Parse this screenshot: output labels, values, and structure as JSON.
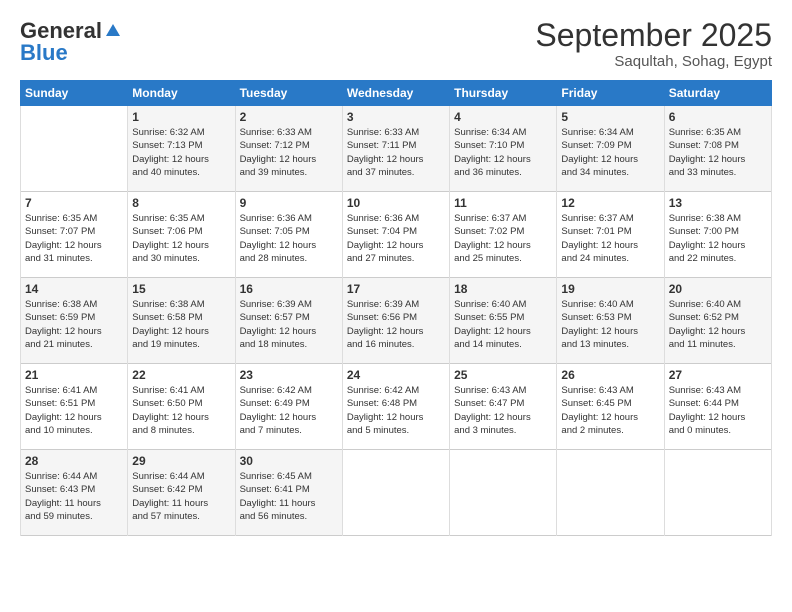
{
  "logo": {
    "general": "General",
    "blue": "Blue",
    "tagline": ""
  },
  "title": "September 2025",
  "location": "Saqultah, Sohag, Egypt",
  "header_days": [
    "Sunday",
    "Monday",
    "Tuesday",
    "Wednesday",
    "Thursday",
    "Friday",
    "Saturday"
  ],
  "weeks": [
    [
      {
        "num": "",
        "info": ""
      },
      {
        "num": "1",
        "info": "Sunrise: 6:32 AM\nSunset: 7:13 PM\nDaylight: 12 hours\nand 40 minutes."
      },
      {
        "num": "2",
        "info": "Sunrise: 6:33 AM\nSunset: 7:12 PM\nDaylight: 12 hours\nand 39 minutes."
      },
      {
        "num": "3",
        "info": "Sunrise: 6:33 AM\nSunset: 7:11 PM\nDaylight: 12 hours\nand 37 minutes."
      },
      {
        "num": "4",
        "info": "Sunrise: 6:34 AM\nSunset: 7:10 PM\nDaylight: 12 hours\nand 36 minutes."
      },
      {
        "num": "5",
        "info": "Sunrise: 6:34 AM\nSunset: 7:09 PM\nDaylight: 12 hours\nand 34 minutes."
      },
      {
        "num": "6",
        "info": "Sunrise: 6:35 AM\nSunset: 7:08 PM\nDaylight: 12 hours\nand 33 minutes."
      }
    ],
    [
      {
        "num": "7",
        "info": "Sunrise: 6:35 AM\nSunset: 7:07 PM\nDaylight: 12 hours\nand 31 minutes."
      },
      {
        "num": "8",
        "info": "Sunrise: 6:35 AM\nSunset: 7:06 PM\nDaylight: 12 hours\nand 30 minutes."
      },
      {
        "num": "9",
        "info": "Sunrise: 6:36 AM\nSunset: 7:05 PM\nDaylight: 12 hours\nand 28 minutes."
      },
      {
        "num": "10",
        "info": "Sunrise: 6:36 AM\nSunset: 7:04 PM\nDaylight: 12 hours\nand 27 minutes."
      },
      {
        "num": "11",
        "info": "Sunrise: 6:37 AM\nSunset: 7:02 PM\nDaylight: 12 hours\nand 25 minutes."
      },
      {
        "num": "12",
        "info": "Sunrise: 6:37 AM\nSunset: 7:01 PM\nDaylight: 12 hours\nand 24 minutes."
      },
      {
        "num": "13",
        "info": "Sunrise: 6:38 AM\nSunset: 7:00 PM\nDaylight: 12 hours\nand 22 minutes."
      }
    ],
    [
      {
        "num": "14",
        "info": "Sunrise: 6:38 AM\nSunset: 6:59 PM\nDaylight: 12 hours\nand 21 minutes."
      },
      {
        "num": "15",
        "info": "Sunrise: 6:38 AM\nSunset: 6:58 PM\nDaylight: 12 hours\nand 19 minutes."
      },
      {
        "num": "16",
        "info": "Sunrise: 6:39 AM\nSunset: 6:57 PM\nDaylight: 12 hours\nand 18 minutes."
      },
      {
        "num": "17",
        "info": "Sunrise: 6:39 AM\nSunset: 6:56 PM\nDaylight: 12 hours\nand 16 minutes."
      },
      {
        "num": "18",
        "info": "Sunrise: 6:40 AM\nSunset: 6:55 PM\nDaylight: 12 hours\nand 14 minutes."
      },
      {
        "num": "19",
        "info": "Sunrise: 6:40 AM\nSunset: 6:53 PM\nDaylight: 12 hours\nand 13 minutes."
      },
      {
        "num": "20",
        "info": "Sunrise: 6:40 AM\nSunset: 6:52 PM\nDaylight: 12 hours\nand 11 minutes."
      }
    ],
    [
      {
        "num": "21",
        "info": "Sunrise: 6:41 AM\nSunset: 6:51 PM\nDaylight: 12 hours\nand 10 minutes."
      },
      {
        "num": "22",
        "info": "Sunrise: 6:41 AM\nSunset: 6:50 PM\nDaylight: 12 hours\nand 8 minutes."
      },
      {
        "num": "23",
        "info": "Sunrise: 6:42 AM\nSunset: 6:49 PM\nDaylight: 12 hours\nand 7 minutes."
      },
      {
        "num": "24",
        "info": "Sunrise: 6:42 AM\nSunset: 6:48 PM\nDaylight: 12 hours\nand 5 minutes."
      },
      {
        "num": "25",
        "info": "Sunrise: 6:43 AM\nSunset: 6:47 PM\nDaylight: 12 hours\nand 3 minutes."
      },
      {
        "num": "26",
        "info": "Sunrise: 6:43 AM\nSunset: 6:45 PM\nDaylight: 12 hours\nand 2 minutes."
      },
      {
        "num": "27",
        "info": "Sunrise: 6:43 AM\nSunset: 6:44 PM\nDaylight: 12 hours\nand 0 minutes."
      }
    ],
    [
      {
        "num": "28",
        "info": "Sunrise: 6:44 AM\nSunset: 6:43 PM\nDaylight: 11 hours\nand 59 minutes."
      },
      {
        "num": "29",
        "info": "Sunrise: 6:44 AM\nSunset: 6:42 PM\nDaylight: 11 hours\nand 57 minutes."
      },
      {
        "num": "30",
        "info": "Sunrise: 6:45 AM\nSunset: 6:41 PM\nDaylight: 11 hours\nand 56 minutes."
      },
      {
        "num": "",
        "info": ""
      },
      {
        "num": "",
        "info": ""
      },
      {
        "num": "",
        "info": ""
      },
      {
        "num": "",
        "info": ""
      }
    ]
  ]
}
